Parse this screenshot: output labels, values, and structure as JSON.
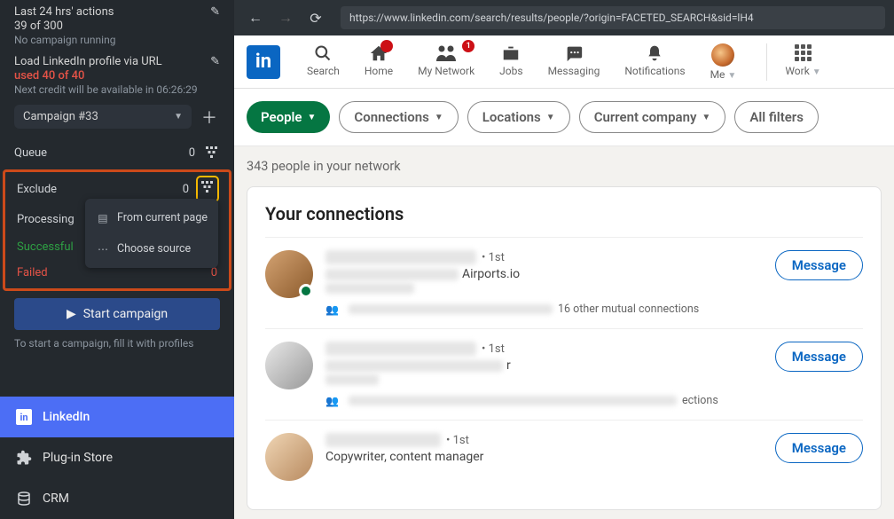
{
  "sidebar": {
    "last_actions_title": "Last 24 hrs' actions",
    "last_actions_count": "39 of 300",
    "campaign_status": "No campaign running",
    "load_title": "Load LinkedIn profile via URL",
    "used_credits": "used 40 of 40",
    "next_credit": "Next credit will be available in 06:26:29",
    "campaign_name": "Campaign #33",
    "queue_label": "Queue",
    "queue_count": "0",
    "exclude_label": "Exclude",
    "exclude_count": "0",
    "processing_label": "Processing",
    "successful_label": "Successful",
    "failed_label": "Failed",
    "failed_count": "0",
    "start_btn": "Start campaign",
    "hint": "To start a campaign, fill it with profiles",
    "menu_from_page": "From current page",
    "menu_choose_source": "Choose source",
    "nav": {
      "linkedin": "LinkedIn",
      "plugin": "Plug-in Store",
      "crm": "CRM"
    }
  },
  "browser": {
    "url": "https://www.linkedin.com/search/results/people/?origin=FACETED_SEARCH&sid=lH4"
  },
  "linkedin": {
    "nav": {
      "search": "Search",
      "home": "Home",
      "home_badge": "",
      "network": "My Network",
      "network_badge": "1",
      "jobs": "Jobs",
      "messaging": "Messaging",
      "notifications": "Notifications",
      "me": "Me",
      "work": "Work"
    },
    "filters": {
      "people": "People",
      "connections": "Connections",
      "locations": "Locations",
      "company": "Current company",
      "all": "All filters"
    },
    "results_text": "343 people in your network",
    "section_title": "Your connections",
    "degree_1st": "• 1st",
    "message_btn": "Message",
    "people": [
      {
        "subtitle_suffix": "Airports.io",
        "mutual_suffix": "16 other mutual connections"
      },
      {
        "subtitle": "",
        "mutual_suffix": "ections"
      },
      {
        "subtitle": "Copywriter, content manager"
      }
    ]
  }
}
